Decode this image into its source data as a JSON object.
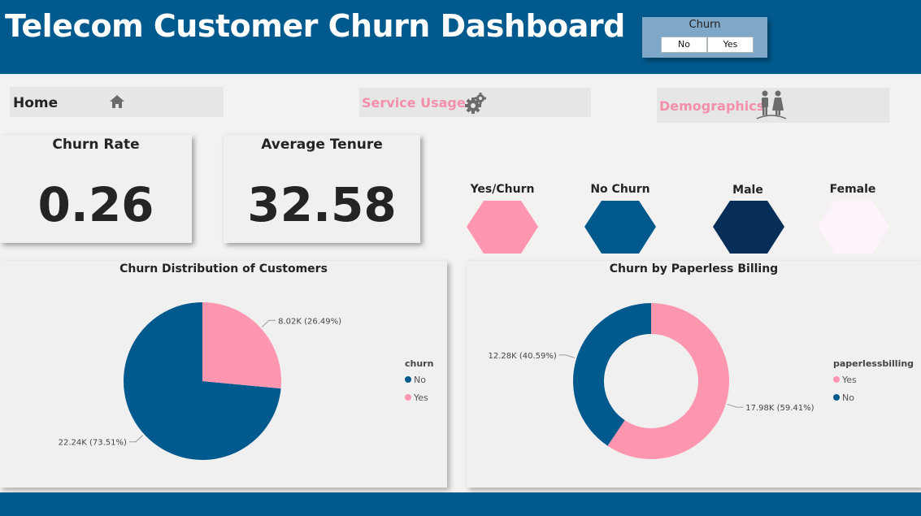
{
  "header": {
    "title": "Telecom Customer Churn Dashboard",
    "slicer": {
      "title": "Churn",
      "options": [
        "No",
        "Yes"
      ]
    }
  },
  "nav": {
    "home": {
      "label": "Home",
      "icon": "home-icon"
    },
    "service": {
      "label": "Service Usage",
      "icon": "gears-icon",
      "color": "#f48fab"
    },
    "demographics": {
      "label": "Demographics",
      "icon": "people-icon",
      "color": "#f48fab"
    }
  },
  "kpis": [
    {
      "title": "Churn Rate",
      "value": "0.26"
    },
    {
      "title": "Average Tenure",
      "value": "32.58"
    }
  ],
  "color_key": [
    {
      "label": "Yes/Churn",
      "color": "#ff96b0"
    },
    {
      "label": "No Churn",
      "color": "#00598c"
    },
    {
      "label": "Male",
      "color": "#062e58"
    },
    {
      "label": "Female",
      "color": "#fdf3fa"
    }
  ],
  "chart_data": [
    {
      "type": "pie",
      "title": "Churn Distribution of Customers",
      "legend_title": "churn",
      "legend_position": "right",
      "categories": [
        "No",
        "Yes"
      ],
      "values": [
        22240,
        8020
      ],
      "percents": [
        73.51,
        26.49
      ],
      "data_labels": [
        "22.24K (73.51%)",
        "8.02K (26.49%)"
      ],
      "colors": [
        "#005a8e",
        "#ff96b0"
      ]
    },
    {
      "type": "pie",
      "subtype": "donut",
      "title": "Churn by Paperless Billing",
      "legend_title": "paperlessbilling",
      "legend_position": "right",
      "categories": [
        "Yes",
        "No"
      ],
      "values": [
        17980,
        12280
      ],
      "percents": [
        59.41,
        40.59
      ],
      "data_labels": [
        "17.98K (59.41%)",
        "12.28K (40.59%)"
      ],
      "colors": [
        "#ff96b0",
        "#005a8e"
      ]
    }
  ]
}
